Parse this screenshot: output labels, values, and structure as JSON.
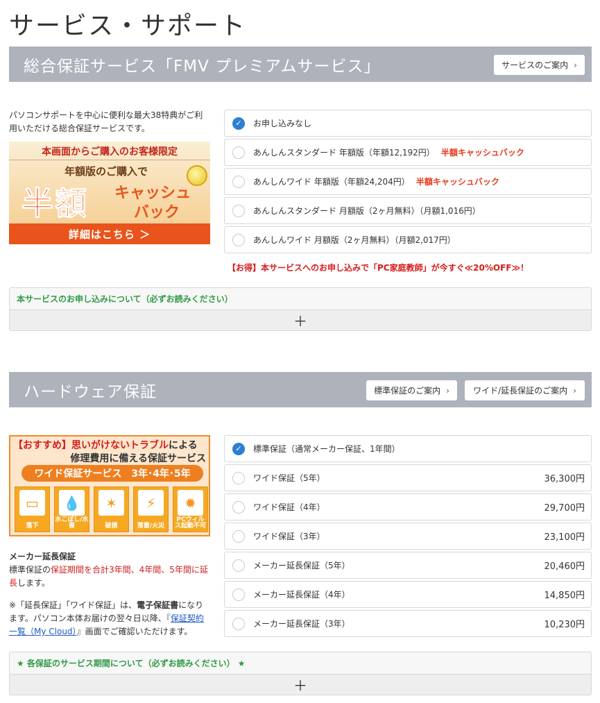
{
  "page": {
    "title": "サービス・サポート"
  },
  "section1": {
    "title": "総合保証サービス「FMV プレミアムサービス」",
    "guide_button": "サービスのご案内",
    "intro": "パソコンサポートを中心に便利な最大38特典がご利用いただける総合保証サービスです。",
    "banner": {
      "top": "本画面からご購入のお客様限定",
      "sub": "年額版のご購入で",
      "big": "半額",
      "cash": "キャッシュ",
      "back": "バック",
      "footer": "詳細はこちら ＞"
    },
    "options": [
      {
        "label": "お申し込みなし",
        "checked": true,
        "badge": ""
      },
      {
        "label": "あんしんスタンダード 年額版（年額12,192円）",
        "checked": false,
        "badge": "半額キャッシュバック"
      },
      {
        "label": "あんしんワイド 年額版（年額24,204円）",
        "checked": false,
        "badge": "半額キャッシュバック"
      },
      {
        "label": "あんしんスタンダード 月額版（2ヶ月無料）（月額1,016円）",
        "checked": false,
        "badge": ""
      },
      {
        "label": "あんしんワイド 月額版（2ヶ月無料）（月額2,017円）",
        "checked": false,
        "badge": ""
      }
    ],
    "promo_note": "【お得】本サービスへのお申し込みで「PC家庭教師」が今すぐ≪20%OFF≫！",
    "accordion_title": "本サービスのお申し込みについて（必ずお読みください）",
    "accordion_toggle": "＋"
  },
  "section2": {
    "title": "ハードウェア保証",
    "btn_standard": "標準保証のご案内",
    "btn_wide": "ワイド/延長保証のご案内",
    "banner": {
      "line1_bracket": "【おすすめ】",
      "line1_red": "思いがけないトラブル",
      "line1_rest": "による",
      "line2": "修理費用に備える保証サービス",
      "pill_a": "ワイド保証サービス",
      "pill_b": "3年･4年･5年",
      "icons": [
        {
          "name": "drop-icon",
          "caption": "落下"
        },
        {
          "name": "water-icon",
          "caption": "水こぼし/水害"
        },
        {
          "name": "break-icon",
          "caption": "破損"
        },
        {
          "name": "lightning-fire-icon",
          "caption": "落雷/火災"
        },
        {
          "name": "virus-icon",
          "caption": "PCウィルス起動不可"
        }
      ]
    },
    "ext": {
      "title": "メーカー延長保証",
      "text_a": "標準保証の",
      "text_red": "保証期間を合計3年間、4年間、5年間に延長",
      "text_b": "します。",
      "note_a": "※「延長保証」「ワイド保証」は、",
      "note_bold": "電子保証書",
      "note_b": "になります。パソコン本体お届けの翌々日以降、『",
      "note_link": "保証契約一覧（My Cloud）",
      "note_c": "』画面でご確認いただけます。"
    },
    "options": [
      {
        "label": "標準保証（通常メーカー保証、1年間）",
        "checked": true,
        "price": ""
      },
      {
        "label": "ワイド保証（5年）",
        "checked": false,
        "price": "36,300円"
      },
      {
        "label": "ワイド保証（4年）",
        "checked": false,
        "price": "29,700円"
      },
      {
        "label": "ワイド保証（3年）",
        "checked": false,
        "price": "23,100円"
      },
      {
        "label": "メーカー延長保証（5年）",
        "checked": false,
        "price": "20,460円"
      },
      {
        "label": "メーカー延長保証（4年）",
        "checked": false,
        "price": "14,850円"
      },
      {
        "label": "メーカー延長保証（3年）",
        "checked": false,
        "price": "10,230円"
      }
    ],
    "accordion_title": "★ 各保証のサービス期間について（必ずお読みください） ★",
    "accordion_toggle": "＋"
  }
}
